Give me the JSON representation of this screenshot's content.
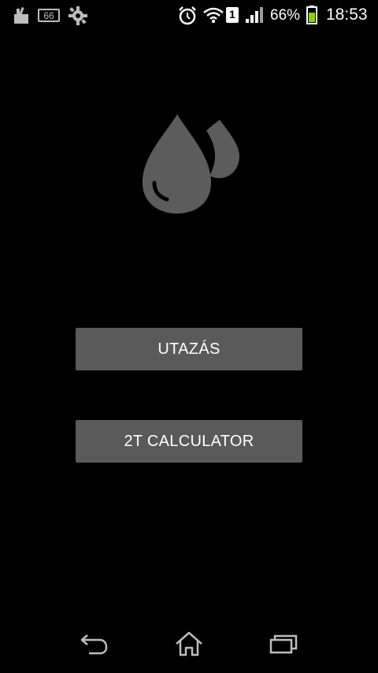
{
  "status_bar": {
    "battery_percent": "66%",
    "time": "18:53",
    "sim_number": "1",
    "notification_icons": [
      "cleaner-icon",
      "radio-66-icon",
      "settings-gear-icon"
    ],
    "system_icons": [
      "alarm-clock-icon",
      "wifi-icon",
      "sim-icon",
      "signal-icon",
      "battery-icon"
    ],
    "battery_color": "#8fd400"
  },
  "main": {
    "buttons": [
      {
        "label": "UTAZÁS"
      },
      {
        "label": "2T CALCULATOR"
      }
    ],
    "logo_icon": "water-drops-icon",
    "button_color": "#5a5a5a",
    "logo_color": "#5c5c5c"
  },
  "nav_bar": {
    "icons": [
      "back-icon",
      "home-icon",
      "recents-icon"
    ]
  }
}
